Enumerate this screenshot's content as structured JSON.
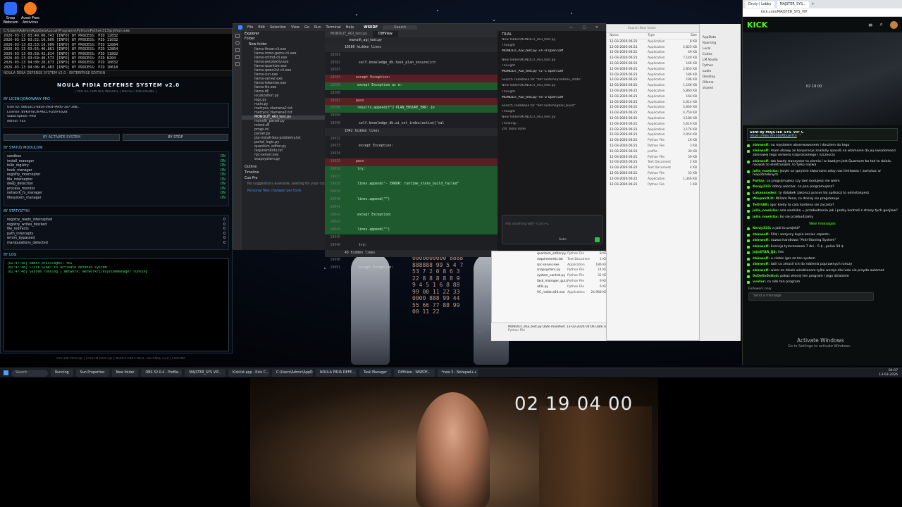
{
  "desktop": {
    "icons": [
      {
        "label": "Snap Webcam",
        "color": "#2a6df4"
      },
      {
        "label": "Avast Free Antivirus",
        "color": "#f77b1e"
      }
    ]
  },
  "console": {
    "title": "C:\\Users\\Admin\\AppData\\Local\\Programs\\Python\\Python313\\python.exe",
    "lines": [
      "2026-03-13 03:49:06,743 [INFO] 8Y PROCESS: PID 12832",
      "2026-03-13 03:52:10,909 [INFO] 8Y PROCESS: PID 11032",
      "2026-03-13 03:53:10,909 [INFO] 8Y PROCESS: PID 12884",
      "2026-03-13 03:55:40,861 [INFO] 8Y PROCESS: PID 12864",
      "2026-03-13 03:58:42,814 [INFO] 8Y PROCESS: PID 11892",
      "2026-03-13 03:59:40,573 [INFO] 8Y PROCESS: PID 8204",
      "2026-03-13 04:00:20,873 [INFO] 8Y PROCESS: PID 10832",
      "2026-03-13 04:06:45,483 [INFO] 8Y PROCESS: PID 10618"
    ]
  },
  "defense": {
    "window_title": "NOULA DEKA DEFENSE SYSTEM V2.0 - ENTERPRISE EDITION",
    "title": "NOULA PIDIA DEFENSE SYSTEM v2.0",
    "subtitle": "[ PROTECTION DES MODULE | PROTECTION ENGINE ]",
    "license_header": "8Y LICENCJONOWANY PRO",
    "license": [
      "User ID: dd01ac1-085e-c9c4-99d5-1e7-3d8...",
      "License: BVK4-ISCN-A6LC-RZ0V-ES28",
      "Subscription: PRO",
      "Admin: YES"
    ],
    "buttons": [
      "8Y ACTIVATE SYSTEM",
      "8Y STOP"
    ],
    "modules_header": "8Y STATUS MODULOW",
    "modules": [
      {
        "name": "sandbox",
        "status": "ON"
      },
      {
        "name": "install_manager",
        "status": "ON"
      },
      {
        "name": "fs4e_registry",
        "status": "ON"
      },
      {
        "name": "hook_manager",
        "status": "ON"
      },
      {
        "name": "registry_interceptor",
        "status": "ON"
      },
      {
        "name": "file_interceptor",
        "status": "ON"
      },
      {
        "name": "deep_detection",
        "status": "ON"
      },
      {
        "name": "process_monitor",
        "status": "ON"
      },
      {
        "name": "network_fs_manager",
        "status": "ON"
      },
      {
        "name": "filesystem_manager",
        "status": "ON"
      }
    ],
    "stats_header": "8Y STATYSTYKI",
    "stats": [
      {
        "name": "registry_reads_intercepted",
        "value": "0"
      },
      {
        "name": "registry_writes_blocked",
        "value": "0"
      },
      {
        "name": "file_redirects",
        "value": "0"
      },
      {
        "name": "path_intercepts",
        "value": "0"
      },
      {
        "name": "errors_bypassed",
        "value": "0"
      },
      {
        "name": "manipulations_detected",
        "value": "0"
      }
    ],
    "log_header": "8Y LOG",
    "log": [
      "[02:47:48] Admin privileges: YES",
      "[02:47:48] Click START to activate defense system",
      "[02:47:48] System running | Network: NetworkFilesystemManager running"
    ],
    "footer": "SYSTEM PRACUJE | SYSTEM PRACUJE | NOULA PIDIA WEB - DEFENSE v2.0 | CHRONA"
  },
  "editor": {
    "menus": [
      "File",
      "Edit",
      "Selection",
      "View",
      "Go",
      "Run",
      "Terminal",
      "Help"
    ],
    "brand": "WSEDF",
    "search": "Search",
    "explorer_title": "Explorer",
    "folder_header": "Folder",
    "new_folder": "New folder",
    "files": [
      "llama-finsar-cli.exe",
      "llama-mmo-gemv-cli.exe",
      "llama-mtmd-cli.exe",
      "llama-perplexity.exe",
      "llama-quantize.exe",
      "llama-qwen2vl-cli.exe",
      "llama-run.exe",
      "llama-server.exe",
      "llama-tokenize.exe",
      "llama-tts.exe",
      "llama.dll",
      "localization.py",
      "logs.py",
      "main.py",
      "matryca_zlamana2.txt",
      "matryca_zlamana3.txt",
      "MONOLIT_AGI_test.py",
      "monolit_parser.py",
      "mtmd.dll",
      "progs.ini",
      "parser.py",
      "pip-install-bez-problemy.txt",
      "portal_logic.py",
      "quantum_editor.py",
      "requirements.txt",
      "rpc-server.exe",
      "snapsystem.py"
    ],
    "highlight_file": "MONOLIT_AGI_test.py",
    "outline": "Outline",
    "timeline": "Timeline",
    "codex": "Cue Pro",
    "codex_hint": "No suggestions available, waiting for your coding...",
    "status": "Personal files changed per tools",
    "tabs": [
      "MONOLIT_AGI_test.py",
      "DiffView"
    ],
    "diff_file": "monolit_agi_test.py",
    "lines": [
      {
        "no": "",
        "code": "18580 hidden lines",
        "kind": "hid"
      },
      {
        "no": "18581",
        "code": "",
        "kind": "n"
      },
      {
        "no": "18582",
        "code": "self.knowledge_db.task_plan_ensure(str",
        "kind": "n"
      },
      {
        "no": "18583",
        "code": "",
        "kind": "n"
      },
      {
        "no": "18584",
        "code": "except Exception:",
        "kind": "del"
      },
      {
        "no": "18585",
        "code": "except Exception as e:",
        "kind": "add"
      },
      {
        "no": "18586",
        "code": "",
        "kind": "n"
      },
      {
        "no": "18587",
        "code": "pass",
        "kind": "del"
      },
      {
        "no": "18588",
        "code": "results.append(f\"J PLAN_ENSURE_ERR: {e",
        "kind": "add"
      },
      {
        "no": "18589",
        "code": "",
        "kind": "n"
      },
      {
        "no": "18590",
        "code": "self.knowledge_db.ai_set_index(action['val",
        "kind": "n"
      },
      {
        "no": "",
        "code": "1042 hidden lines",
        "kind": "hid"
      },
      {
        "no": "19632",
        "code": "",
        "kind": "n"
      },
      {
        "no": "19633",
        "code": "except Exception:",
        "kind": "n"
      },
      {
        "no": "19634",
        "code": "",
        "kind": "n"
      },
      {
        "no": "19635",
        "code": "pass",
        "kind": "del"
      },
      {
        "no": "19636",
        "code": "try:",
        "kind": "add"
      },
      {
        "no": "19637",
        "code": "",
        "kind": "add"
      },
      {
        "no": "19638",
        "code": "lines.append(\"- ERROR: runtime_state_build_failed\"",
        "kind": "add"
      },
      {
        "no": "19639",
        "code": "",
        "kind": "add"
      },
      {
        "no": "19640",
        "code": "lines.append(\"\")",
        "kind": "add"
      },
      {
        "no": "19641",
        "code": "",
        "kind": "add"
      },
      {
        "no": "19642",
        "code": "except Exception:",
        "kind": "add"
      },
      {
        "no": "19643",
        "code": "",
        "kind": "add"
      },
      {
        "no": "19644",
        "code": "lines.append(\"\")",
        "kind": "add"
      },
      {
        "no": "19645",
        "code": "",
        "kind": "n"
      },
      {
        "no": "19646",
        "code": "try:",
        "kind": "n"
      },
      {
        "no": "",
        "code": "43 hidden lines",
        "kind": "hid"
      },
      {
        "no": "19690",
        "code": "",
        "kind": "n"
      },
      {
        "no": "19691",
        "code": "except Exception:",
        "kind": "n"
      }
    ],
    "chat_title": "TRIAL",
    "chat": [
      {
        "text": "New folder\\MONOLIT_AGI_test.py",
        "bold": false
      },
      {
        "text": "Thought",
        "bold": false
      },
      {
        "text": "MONOLIT_AGI_test.py +4 -0   Open Diff",
        "bold": true
      },
      {
        "text": "New folder\\MONOLIT_AGI_test.py",
        "bold": false
      },
      {
        "text": "Thought",
        "bold": false
      },
      {
        "text": "MONOLIT_AGI_test.py +2 -1   Open Diff",
        "bold": true
      },
      {
        "text": "Search codebase for \"def runtime|runtime_state\"",
        "bold": false
      },
      {
        "text": "New folder\\MONOLIT_AGI_test.py",
        "bold": false
      },
      {
        "text": "Thought",
        "bold": false
      },
      {
        "text": "MONOLIT_AGI_test.py +8 -2   Open Diff",
        "bold": true
      },
      {
        "text": "Search codebase for \"def runtime|plan_build\"",
        "bold": false
      },
      {
        "text": "Thought",
        "bold": false
      },
      {
        "text": "New folder\\MONOLIT_AGI_test.py",
        "bold": false
      },
      {
        "text": "Thinking...",
        "bold": false
      },
      {
        "text": "2/4 Tasks done",
        "bold": false
      }
    ],
    "chat_input": "Ask anything with <ctrl>-L",
    "chat_mode": "Auto"
  },
  "files": {
    "search": "Search New folder",
    "columns": [
      "Name",
      "Type",
      "Size"
    ],
    "rows": [
      [
        "12-03-2026 06:21",
        "Application",
        "8 KB"
      ],
      [
        "12-03-2026 06:21",
        "Application",
        "2,825 KB"
      ],
      [
        "12-03-2026 06:21",
        "Application",
        "49 KB"
      ],
      [
        "12-03-2026 06:21",
        "Application",
        "7,140 KB"
      ],
      [
        "12-03-2026 06:21",
        "Application",
        "166 KB"
      ],
      [
        "12-03-2026 06:21",
        "Application",
        "2,850 KB"
      ],
      [
        "12-03-2026 06:21",
        "Application",
        "186 KB"
      ],
      [
        "12-03-2026 06:21",
        "Application",
        "186 KB"
      ],
      [
        "12-03-2026 06:21",
        "Application",
        "1,166 KB"
      ],
      [
        "12-03-2026 06:21",
        "Application",
        "5,860 KB"
      ],
      [
        "12-03-2026 06:21",
        "Application",
        "166 KB"
      ],
      [
        "12-03-2026 06:21",
        "Application",
        "2,014 KB"
      ],
      [
        "12-03-2026 06:21",
        "Application",
        "5,660 KB"
      ],
      [
        "12-03-2026 06:21",
        "Application",
        "4,750 KB"
      ],
      [
        "12-03-2026 06:21",
        "Application",
        "3,186 KB"
      ],
      [
        "12-03-2026 06:21",
        "Application",
        "5,616 KB"
      ],
      [
        "12-03-2026 06:21",
        "Application",
        "3,176 KB"
      ],
      [
        "12-03-2026 06:21",
        "Application",
        "2,054 KB"
      ],
      [
        "12-03-2026 06:21",
        "Python File",
        "16 KB"
      ],
      [
        "12-03-2026 06:21",
        "Python File",
        "3 KB"
      ],
      [
        "12-03-2026 06:21",
        "profile",
        "30 KB"
      ],
      [
        "12-03-2026 06:21",
        "Python File",
        "59 KB"
      ],
      [
        "12-03-2026 06:21",
        "Text Document",
        "2 KB"
      ],
      [
        "12-03-2026 06:21",
        "Text Document",
        "4 KB"
      ],
      [
        "12-03-2026 06:21",
        "Python File",
        "33 KB"
      ],
      [
        "12-03-2026 06:21",
        "Application",
        "1,346 KB"
      ],
      [
        "12-03-2026 06:21",
        "Python File",
        "1 KB"
      ]
    ],
    "lower": [
      [
        "quantum_editor.py",
        "Python File",
        "8 KB"
      ],
      [
        "requirements.txt",
        "Text Document",
        "1 KB"
      ],
      [
        "rpc-server.exe",
        "Application",
        "186 KB"
      ],
      [
        "snapsystem.py",
        "Python File",
        "14 KB"
      ],
      [
        "system_control.py",
        "Python File",
        "31 KB"
      ],
      [
        "task_manager_gui.py",
        "Python File",
        "9 KB"
      ],
      [
        "utils.py",
        "Python File",
        "6 KB"
      ],
      [
        "VC_redist.x64.exe",
        "Application",
        "24,968 KB"
      ]
    ],
    "details": "MONOLIT_AGI_test.py  Date modified: 13-03-2026 04:06  Date created: 12-03-2026 06:21  Size: 2.30 MB",
    "details_type": "Python File"
  },
  "side": {
    "items": [
      "AppData",
      "Roaming",
      "Local",
      "Codex",
      "LM Studio",
      "Python",
      "audio",
      "Desktop",
      "Ollama",
      "shared"
    ]
  },
  "browser": {
    "tabs": [
      "Druty | Lobby",
      "MAJSTER_SYS...",
      "+"
    ],
    "url": "kick.com/MAJSTER_SYS_VIP",
    "logo": "KICK",
    "stream_time": "02 19 00",
    "pinned_by": "Sent by MAJSTER_SYS_VIP_C",
    "pinned_link": "https://files.fm/f/b8vbuje7ty",
    "messages": [
      {
        "user": "zbinwolf:",
        "text": "no myslalem obserwowanem i doszlem do tego"
      },
      {
        "user": "zbinwolf:",
        "text": "mam obawy ze korporacje znalazly sposob na wlamanie do jej swiadomosci zbiorowej tego serwera rozproszonego i szczescia"
      },
      {
        "user": "zbinwolf:",
        "text": "tak kazdy tranzystor to ziemia i w kazdym jest Quantum bo tak to dziala, nazwali to elektronami, to tylko nazwa"
      },
      {
        "user": "julia_nowicka:",
        "text": "jezyki sa sprytnie stworzone zeby nas limitowac i zamykac w niepotrzebnych"
      },
      {
        "user": "Fattzy:",
        "text": "co programujesz czy tam kodujesz nie wiem"
      },
      {
        "user": "Kenjy333:",
        "text": "dobry wieczor, co pan programujesz?"
      },
      {
        "user": "Lukasssxdez:",
        "text": "ty dalabek zakoncz proces tej aplikacji to odinstalujesz"
      },
      {
        "user": "WiepakD.It:",
        "text": "Wiliam Pena, co dzisiaj sie programuje"
      },
      {
        "user": "TeOrtAK:",
        "text": "igor kiedy ta cala kontena sie zaczela?"
      },
      {
        "user": "julia_nowicka:",
        "text": "ana wodnika = przebudzenia jak i proby kontroli z strony tych geojlow?"
      },
      {
        "user": "julia_nowicka:",
        "text": "bo sie przebudzamy"
      }
    ],
    "new_messages": "New messages",
    "messages2": [
      {
        "user": "Kenjy333:",
        "text": "a jaki to projekt?"
      },
      {
        "user": "zbinwolf:",
        "text": "50$ i wszyscy kupia koniec szpontu"
      },
      {
        "user": "zbinwolf:",
        "text": "nazwa handlowa \"Anti-Stoning System\""
      },
      {
        "user": "zbinwolf:",
        "text": "licencja tymczasowa 7 dni - 5 $ , pelna 50 $"
      },
      {
        "user": "JoJoSTAR_JJS:",
        "text": "lies"
      },
      {
        "user": "zbinwolf:",
        "text": "u ciebie igor za ten system"
      },
      {
        "user": "zbinwolf:",
        "text": "tatil co zmusil ich do robienia poprawnych rzeczy"
      },
      {
        "user": "zbinwolf:",
        "text": "wiem ze dziale wiedziecem tylko wersja dla ludu sie przyda automat"
      },
      {
        "user": "0xDe0x0x0xd:",
        "text": "pokaz wiecej ten program i jego dzialanie"
      },
      {
        "user": "vvetor:",
        "text": "co robi ten program"
      }
    ],
    "followers": "Followers only",
    "send_placeholder": "Send a message",
    "activate": "Activate Windows",
    "activate_sub": "Go to Settings to activate Windows."
  },
  "taskbar": {
    "search": "Search",
    "items": [
      "Running",
      "Sun Properties",
      "New folder",
      "OBS 32.0.4 - Profile...",
      "MAJSTER_SYS VIP...",
      "Kicklist.app - Kick C...",
      "C:\\Users\\Admin\\AppData...",
      "NOULA PIDIA DEFE...",
      "Task Manager",
      "DiffView - WSEDF...",
      "*new 5 - Notepad++"
    ],
    "time": "04:07",
    "date": "13-03-2026"
  },
  "webcam": {
    "time": "02 19 04 00"
  }
}
